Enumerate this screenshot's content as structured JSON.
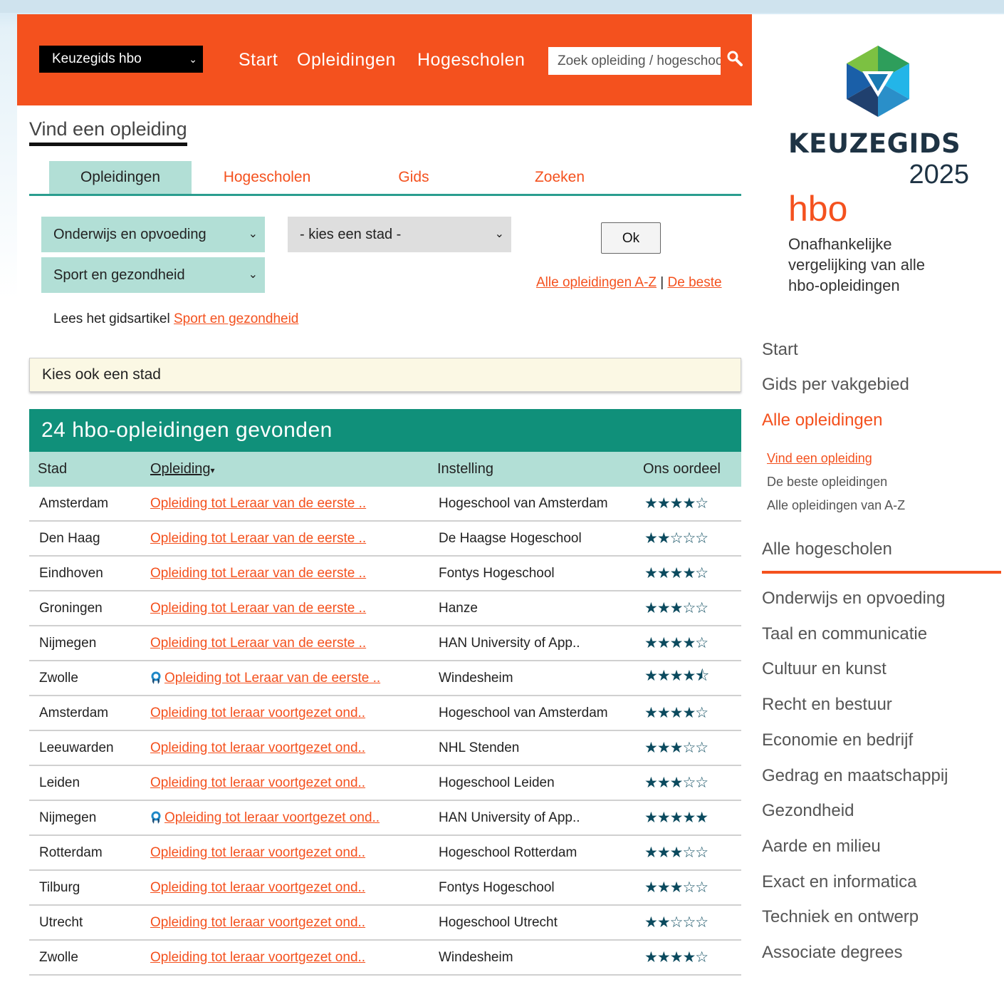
{
  "header": {
    "site_select": "Keuzegids hbo",
    "nav": [
      "Start",
      "Opleidingen",
      "Hogescholen"
    ],
    "search_placeholder": "Zoek opleiding / hogeschool"
  },
  "find": {
    "title": "Vind een opleiding",
    "tabs": [
      "Opleidingen",
      "Hogescholen",
      "Gids",
      "Zoeken"
    ],
    "select_area": "Onderwijs en opvoeding",
    "select_city": "- kies een stad -",
    "select_field": "Sport en gezondheid",
    "ok_label": "Ok",
    "link_az": "Alle opleidingen A-Z",
    "link_sep": "|",
    "link_best": "De beste",
    "article_prefix": "Lees het gidsartikel ",
    "article_link": "Sport en gezondheid"
  },
  "city_box": "Kies ook een stad",
  "results": {
    "heading": "24 hbo-opleidingen gevonden",
    "columns": [
      "Stad",
      "Opleiding",
      "Instelling",
      "Ons oordeel"
    ],
    "rows": [
      {
        "city": "Amsterdam",
        "program": "Opleiding tot Leraar van de eerste ..",
        "institution": "Hogeschool van Amsterdam",
        "stars": "★★★★☆",
        "award": false
      },
      {
        "city": "Den Haag",
        "program": "Opleiding tot Leraar van de eerste ..",
        "institution": "De Haagse Hogeschool",
        "stars": "★★☆☆☆",
        "award": false
      },
      {
        "city": "Eindhoven",
        "program": "Opleiding tot Leraar van de eerste ..",
        "institution": "Fontys Hogeschool",
        "stars": "★★★★☆",
        "award": false
      },
      {
        "city": "Groningen",
        "program": "Opleiding tot Leraar van de eerste ..",
        "institution": "Hanze",
        "stars": "★★★☆☆",
        "award": false
      },
      {
        "city": "Nijmegen",
        "program": "Opleiding tot Leraar van de eerste ..",
        "institution": "HAN University of App..",
        "stars": "★★★★☆",
        "award": false
      },
      {
        "city": "Zwolle",
        "program": "Opleiding tot Leraar van de eerste ..",
        "institution": "Windesheim",
        "stars": "★★★★⯪",
        "award": true
      },
      {
        "city": "Amsterdam",
        "program": "Opleiding tot leraar voortgezet ond..",
        "institution": "Hogeschool van Amsterdam",
        "stars": "★★★★☆",
        "award": false
      },
      {
        "city": "Leeuwarden",
        "program": "Opleiding tot leraar voortgezet ond..",
        "institution": "NHL Stenden",
        "stars": "★★★☆☆",
        "award": false
      },
      {
        "city": "Leiden",
        "program": "Opleiding tot leraar voortgezet ond..",
        "institution": "Hogeschool Leiden",
        "stars": "★★★☆☆",
        "award": false
      },
      {
        "city": "Nijmegen",
        "program": "Opleiding tot leraar voortgezet ond..",
        "institution": "HAN University of App..",
        "stars": "★★★★★",
        "award": true
      },
      {
        "city": "Rotterdam",
        "program": "Opleiding tot leraar voortgezet ond..",
        "institution": "Hogeschool Rotterdam",
        "stars": "★★★☆☆",
        "award": false
      },
      {
        "city": "Tilburg",
        "program": "Opleiding tot leraar voortgezet ond..",
        "institution": "Fontys Hogeschool",
        "stars": "★★★☆☆",
        "award": false
      },
      {
        "city": "Utrecht",
        "program": "Opleiding tot leraar voortgezet ond..",
        "institution": "Hogeschool Utrecht",
        "stars": "★★☆☆☆",
        "award": false
      },
      {
        "city": "Zwolle",
        "program": "Opleiding tot leraar voortgezet ond..",
        "institution": "Windesheim",
        "stars": "★★★★☆",
        "award": false
      }
    ]
  },
  "sidebar": {
    "logo_word": "KEUZEGIDS",
    "logo_year": "2025",
    "logo_hbo": "hbo",
    "logo_tagline": "Onafhankelijke vergelijking van alle hbo-opleidingen",
    "menu": [
      "Start",
      "Gids per vakgebied",
      "Alle opleidingen"
    ],
    "submenu": [
      "Vind een opleiding",
      "De beste opleidingen",
      "Alle opleidingen van A-Z"
    ],
    "menu_hogescholen": "Alle hogescholen",
    "fields": [
      "Onderwijs en opvoeding",
      "Taal en communicatie",
      "Cultuur en kunst",
      "Recht en bestuur",
      "Economie en bedrijf",
      "Gedrag en maatschappij",
      "Gezondheid",
      "Aarde en milieu",
      "Exact en informatica",
      "Techniek en ontwerp",
      "Associate degrees"
    ]
  },
  "colors": {
    "accent": "#f4511e",
    "teal": "#10907a",
    "mint": "#b2dfd6",
    "star": "#0b4a5e"
  }
}
